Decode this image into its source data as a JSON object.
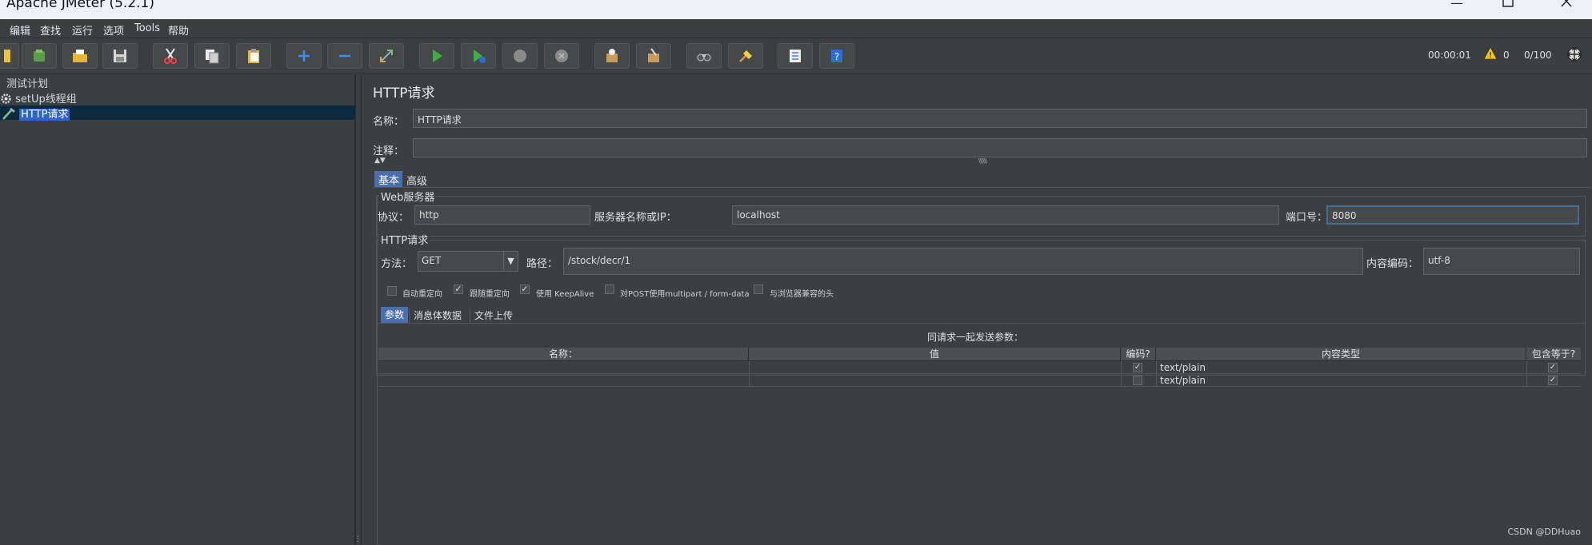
{
  "window": {
    "title": "Apache JMeter (5.2.1)"
  },
  "menu": [
    "编辑",
    "查找",
    "运行",
    "选项",
    "Tools",
    "帮助"
  ],
  "toolbar": {
    "buttons": [
      "new",
      "templates",
      "open",
      "save",
      "cut",
      "copy",
      "paste",
      "expand",
      "collapse",
      "toggle",
      "start",
      "start-no-pauses",
      "stop",
      "shutdown",
      "clear",
      "clear-all",
      "search",
      "reset-search",
      "function-helper",
      "help"
    ],
    "timer": "00:00:01",
    "warnings": "0",
    "threads": "0/100"
  },
  "tree": {
    "items": [
      {
        "label": "测试计划",
        "icon": "test-plan-icon"
      },
      {
        "label": "setUp线程组",
        "icon": "gear-icon"
      },
      {
        "label": "HTTP请求",
        "icon": "pipette-icon",
        "selected": true
      }
    ]
  },
  "panel": {
    "title": "HTTP请求",
    "name_label": "名称：",
    "name_value": "HTTP请求",
    "comment_label": "注释：",
    "comment_value": "",
    "tabs": {
      "basic": "基本",
      "advanced": "高级"
    },
    "web_server": {
      "title": "Web服务器",
      "protocol_label": "协议：",
      "protocol_value": "http",
      "server_label": "服务器名称或IP：",
      "server_value": "localhost",
      "port_label": "端口号：",
      "port_value": "8080"
    },
    "http_request": {
      "title": "HTTP请求",
      "method_label": "方法：",
      "method_value": "GET",
      "path_label": "路径：",
      "path_value": "/stock/decr/1",
      "encoding_label": "内容编码：",
      "encoding_value": "utf-8"
    },
    "checkboxes": [
      {
        "label": "自动重定向",
        "checked": false
      },
      {
        "label": "跟随重定向",
        "checked": true
      },
      {
        "label": "使用 KeepAlive",
        "checked": true
      },
      {
        "label": "对POST使用multipart / form-data",
        "checked": false
      },
      {
        "label": "与浏览器兼容的头",
        "checked": false
      }
    ],
    "sub_tabs": [
      "参数",
      "消息体数据",
      "文件上传"
    ],
    "params": {
      "caption": "同请求一起发送参数：",
      "columns": [
        "名称：",
        "值",
        "编码?",
        "内容类型",
        "包含等于?"
      ],
      "rows": [
        {
          "name": "",
          "value": "",
          "encode": true,
          "content_type": "text/plain",
          "include_equals": true
        },
        {
          "name": "",
          "value": "",
          "encode": false,
          "content_type": "text/plain",
          "include_equals": true
        }
      ]
    }
  },
  "watermark": "CSDN @DDHuao"
}
